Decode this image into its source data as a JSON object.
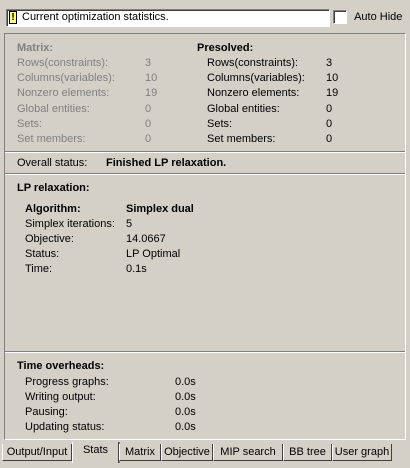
{
  "header": {
    "info_text": "Current optimization statistics.",
    "autohide_label": "Auto Hide",
    "autohide_checked": false
  },
  "matrix": {
    "title": "Matrix:",
    "rows": [
      {
        "label": "Rows(constraints):",
        "value": "3"
      },
      {
        "label": "Columns(variables):",
        "value": "10"
      },
      {
        "label": "Nonzero elements:",
        "value": "19"
      },
      {
        "label": "Global entities:",
        "value": "0"
      },
      {
        "label": "Sets:",
        "value": "0"
      },
      {
        "label": "Set members:",
        "value": "0"
      }
    ]
  },
  "presolved": {
    "title": "Presolved:",
    "rows": [
      {
        "label": "Rows(constraints):",
        "value": "3"
      },
      {
        "label": "Columns(variables):",
        "value": "10"
      },
      {
        "label": "Nonzero elements:",
        "value": "19"
      },
      {
        "label": "Global entities:",
        "value": "0"
      },
      {
        "label": "Sets:",
        "value": "0"
      },
      {
        "label": "Set members:",
        "value": "0"
      }
    ]
  },
  "overall": {
    "label": "Overall status:",
    "value": "Finished LP relaxation."
  },
  "lp": {
    "title": "LP relaxation:",
    "algorithm_label": "Algorithm:",
    "algorithm_value": "Simplex dual",
    "rows": [
      {
        "label": "Simplex iterations:",
        "value": "5"
      },
      {
        "label": "Objective:",
        "value": "14.0667"
      },
      {
        "label": "Status:",
        "value": "LP Optimal"
      },
      {
        "label": "Time:",
        "value": "0.1s"
      }
    ]
  },
  "overheads": {
    "title": "Time overheads:",
    "rows": [
      {
        "label": "Progress graphs:",
        "value": "0.0s"
      },
      {
        "label": "Writing output:",
        "value": "0.0s"
      },
      {
        "label": "Pausing:",
        "value": "0.0s"
      },
      {
        "label": "Updating status:",
        "value": "0.0s"
      }
    ]
  },
  "tabs": [
    {
      "label": "Output/Input",
      "active": false
    },
    {
      "label": "Stats",
      "active": true
    },
    {
      "label": "Matrix",
      "active": false
    },
    {
      "label": "Objective",
      "active": false
    },
    {
      "label": "MIP search",
      "active": false
    },
    {
      "label": "BB tree",
      "active": false
    },
    {
      "label": "User graph",
      "active": false
    }
  ]
}
